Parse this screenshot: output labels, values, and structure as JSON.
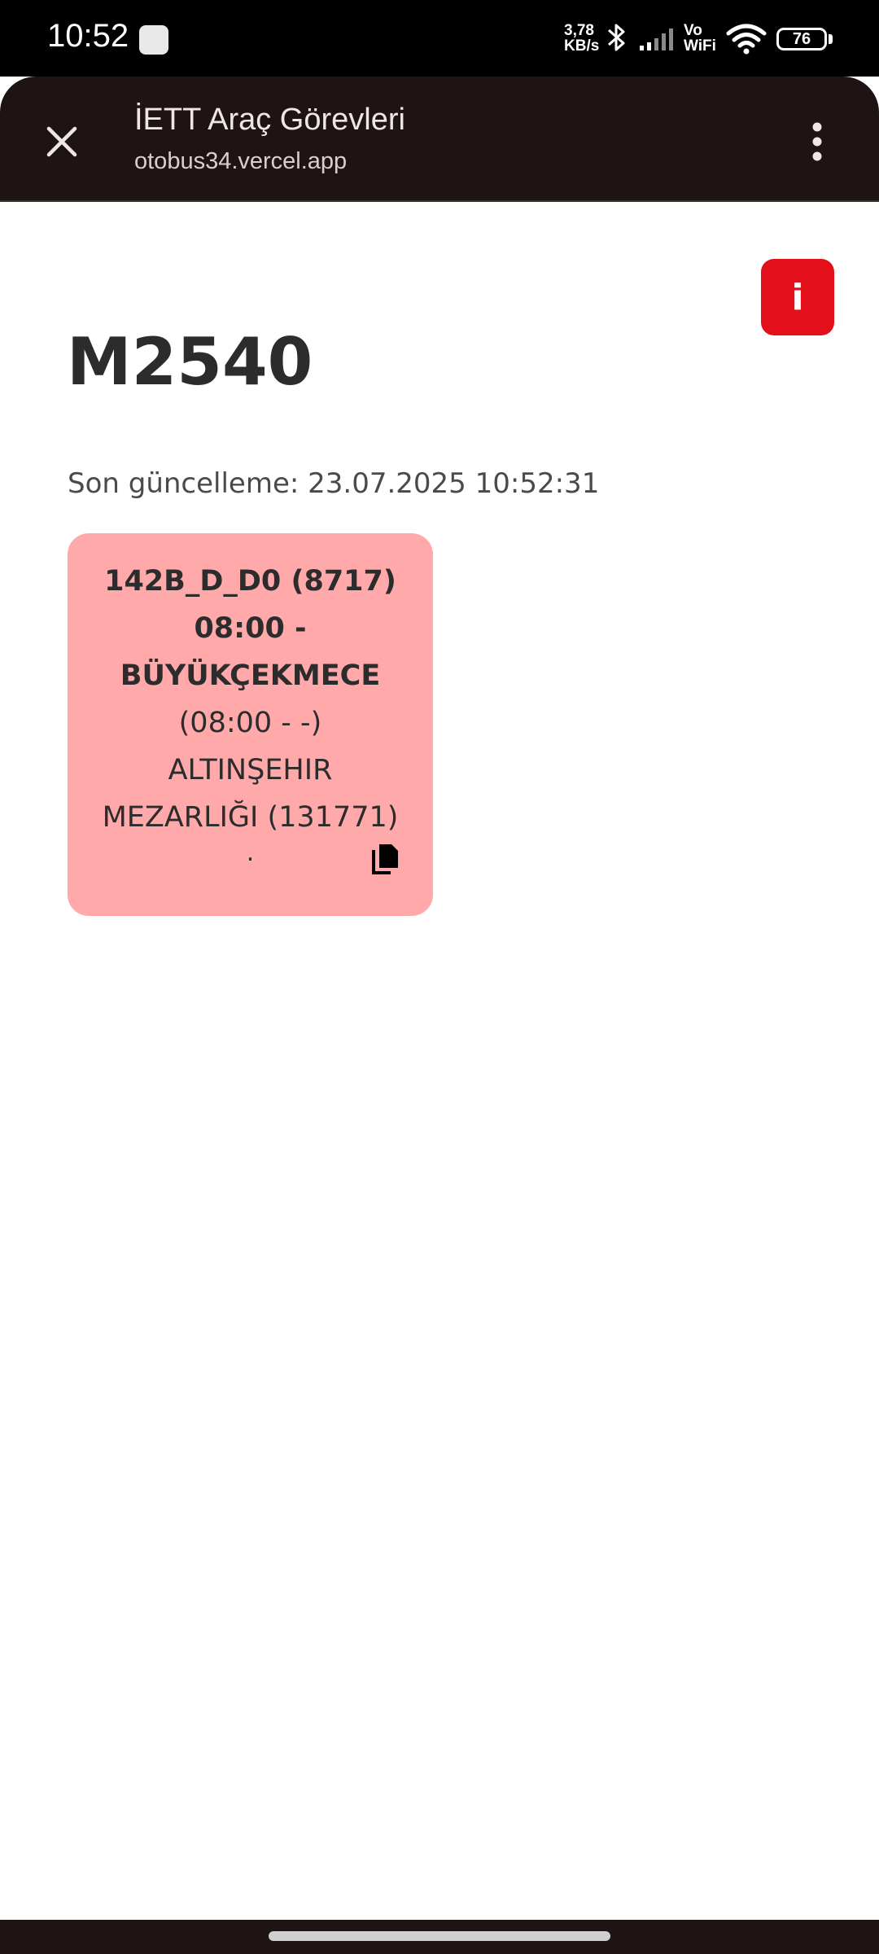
{
  "status_bar": {
    "time": "10:52",
    "net_speed_value": "3,78",
    "net_speed_unit": "KB/s",
    "vowifi_top": "Vo",
    "vowifi_bottom": "WiFi",
    "battery": "76"
  },
  "browser": {
    "title": "İETT Araç Görevleri",
    "url": "otobus34.vercel.app"
  },
  "page": {
    "info_label": "i",
    "vehicle_id": "M2540",
    "last_update": "Son güncelleme: 23.07.2025 10:52:31"
  },
  "tasks": [
    {
      "route_code": "142B_D_D0 (8717)",
      "route_time": "08:00 -",
      "route_destination": "BÜYÜKÇEKMECE",
      "time_range": "(08:00 - -)",
      "stop_line1": "ALTINŞEHIR",
      "stop_line2": "MEZARLIĞI (131771)",
      "dot": "."
    }
  ],
  "colors": {
    "card_background": "#ffa9ab",
    "info_button": "#e3101b",
    "browser_bar": "#1e1414"
  },
  "icons": {
    "close": "close-icon",
    "menu": "more-vert-icon",
    "copy": "copy-icon"
  }
}
